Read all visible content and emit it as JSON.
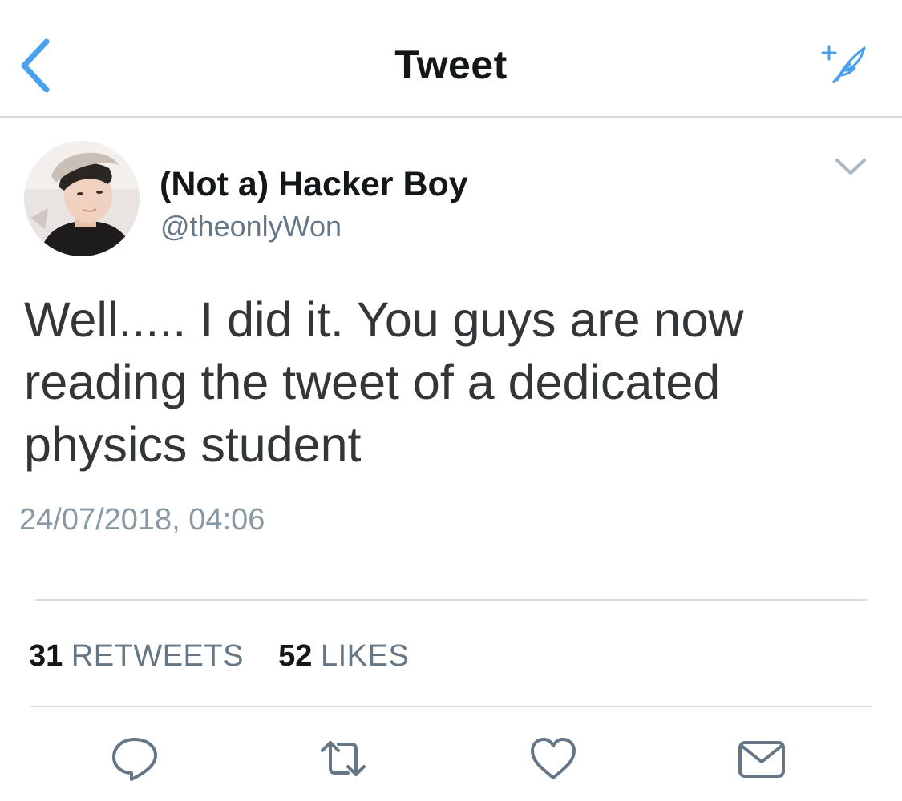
{
  "header": {
    "title": "Tweet",
    "back_icon": "chevron-left-icon",
    "compose_icon": "compose-tweet-icon",
    "accent_color": "#4aa1eb"
  },
  "tweet": {
    "author": {
      "display_name": "(Not a) Hacker Boy",
      "handle": "@theonlyWon"
    },
    "text": "Well..... I did it. You guys are now\nreading the tweet of a dedicated\nphysics student",
    "timestamp": "24/07/2018, 04:06",
    "stats": {
      "retweets_count": "31",
      "retweets_label": "RETWEETS",
      "likes_count": "52",
      "likes_label": "LIKES"
    }
  },
  "actions": [
    {
      "name": "reply",
      "icon": "reply-icon"
    },
    {
      "name": "retweet",
      "icon": "retweet-icon"
    },
    {
      "name": "like",
      "icon": "heart-icon"
    },
    {
      "name": "share",
      "icon": "share-envelope-icon"
    }
  ]
}
